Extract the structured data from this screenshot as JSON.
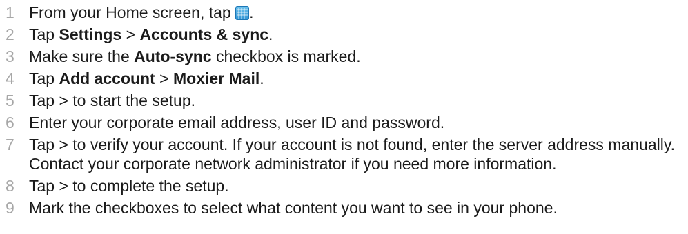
{
  "steps": [
    {
      "number": "1",
      "parts": [
        {
          "t": "From your Home screen, tap "
        },
        {
          "icon": "app-grid-icon"
        },
        {
          "t": "."
        }
      ]
    },
    {
      "number": "2",
      "parts": [
        {
          "t": "Tap "
        },
        {
          "b": "Settings"
        },
        {
          "t": " > "
        },
        {
          "b": "Accounts & sync"
        },
        {
          "t": "."
        }
      ]
    },
    {
      "number": "3",
      "parts": [
        {
          "t": "Make sure the "
        },
        {
          "b": "Auto-sync"
        },
        {
          "t": " checkbox is marked."
        }
      ]
    },
    {
      "number": "4",
      "parts": [
        {
          "t": "Tap "
        },
        {
          "b": "Add account"
        },
        {
          "t": " > "
        },
        {
          "b": "Moxier Mail"
        },
        {
          "t": "."
        }
      ]
    },
    {
      "number": "5",
      "parts": [
        {
          "t": "Tap > to start the setup."
        }
      ]
    },
    {
      "number": "6",
      "parts": [
        {
          "t": "Enter your corporate email address, user ID and password."
        }
      ]
    },
    {
      "number": "7",
      "parts": [
        {
          "t": "Tap > to verify your account. If your account is not found, enter the server address manually. Contact your corporate network administrator if you need more information."
        }
      ]
    },
    {
      "number": "8",
      "parts": [
        {
          "t": "Tap > to complete the setup."
        }
      ]
    },
    {
      "number": "9",
      "parts": [
        {
          "t": "Mark the checkboxes to select what content you want to see in your phone."
        }
      ]
    }
  ]
}
